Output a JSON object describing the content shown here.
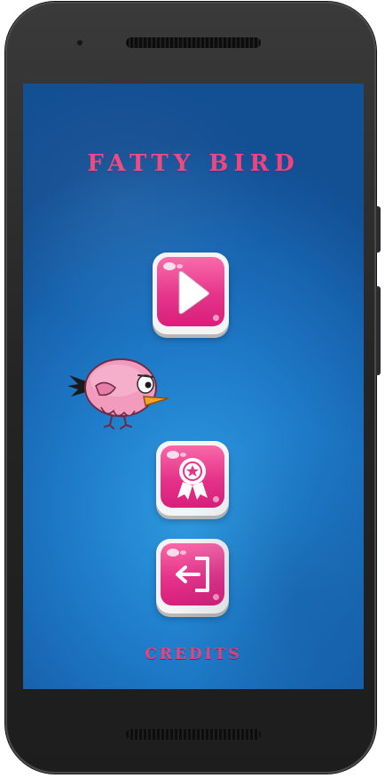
{
  "game": {
    "title": "FATTY BIRD",
    "credits_label": "CREDITS"
  },
  "menu": {
    "buttons": [
      {
        "id": "play",
        "icon": "play-icon"
      },
      {
        "id": "achievements",
        "icon": "award-ribbon-icon"
      },
      {
        "id": "exit",
        "icon": "exit-door-icon"
      }
    ]
  },
  "colors": {
    "title": "#f0437d",
    "button_pink": "#e5338a",
    "background_blue": "#1f7dcb",
    "bird_pink": "#f29bbd"
  }
}
